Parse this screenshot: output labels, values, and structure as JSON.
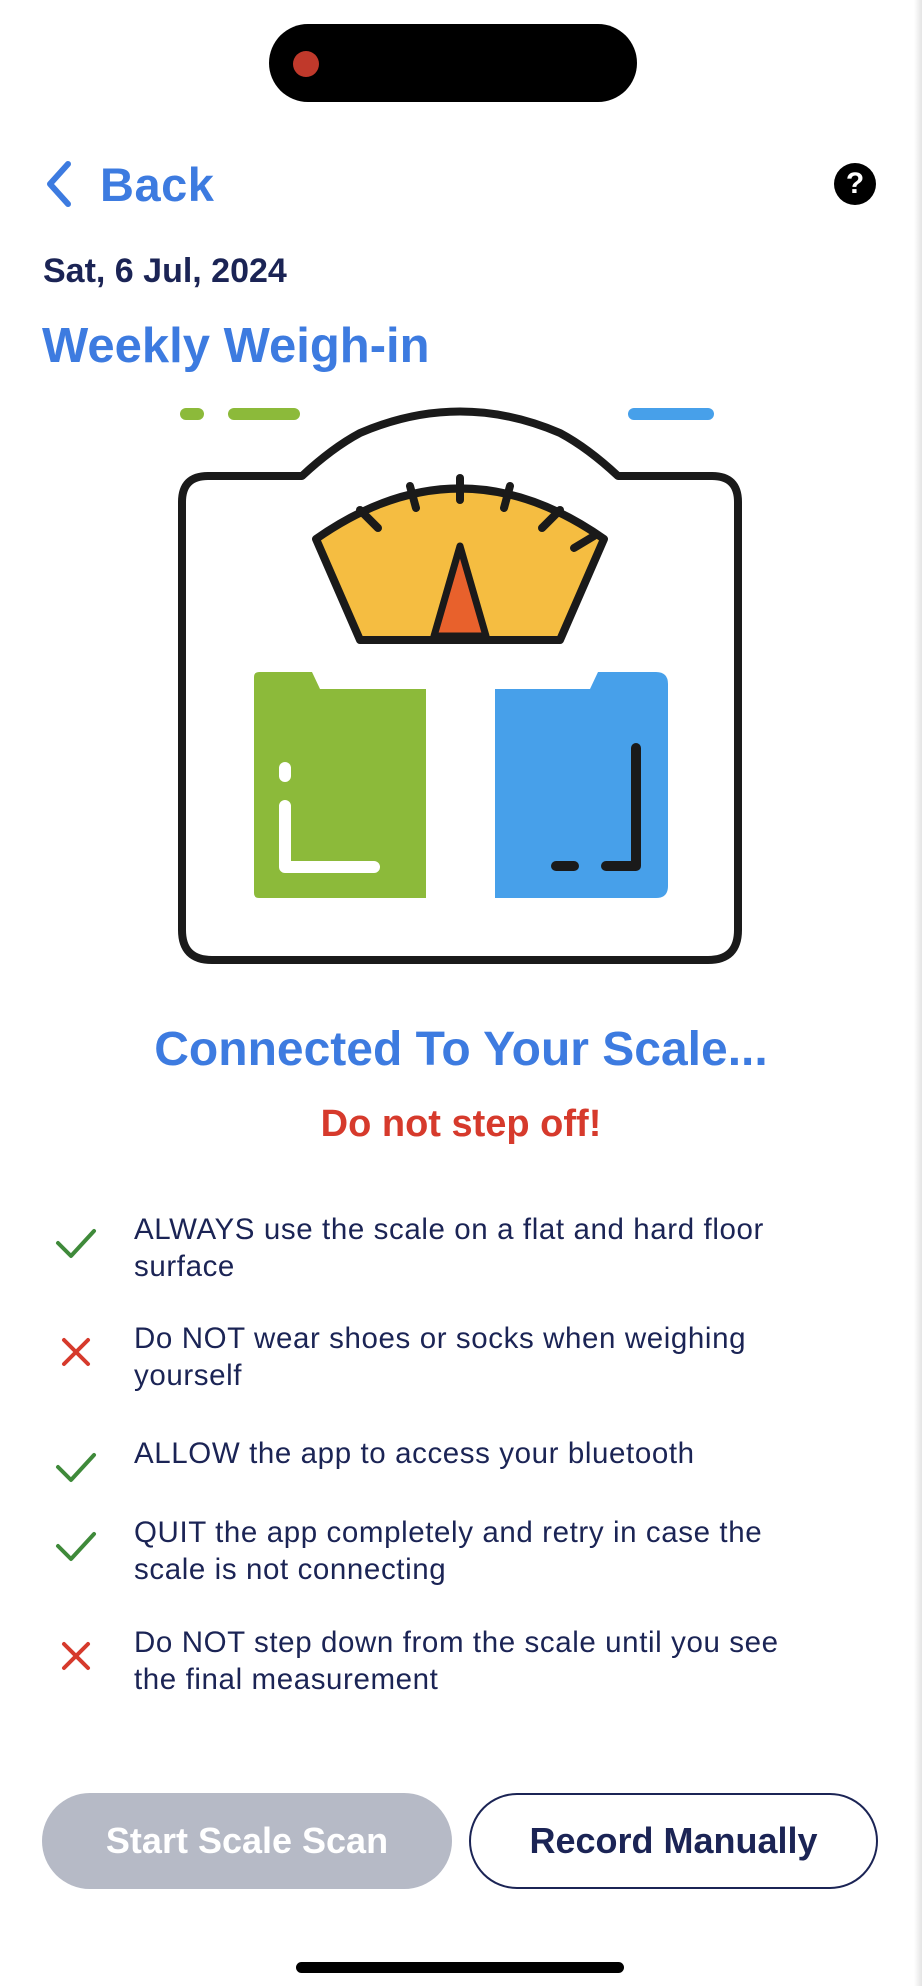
{
  "nav": {
    "back_label": "Back",
    "help_glyph": "?"
  },
  "header": {
    "date": "Sat, 6 Jul, 2024",
    "title": "Weekly Weigh-in"
  },
  "illustration": {
    "name": "bathroom-scale-icon",
    "colors": {
      "dial": "#f5bd41",
      "needle": "#e8612c",
      "left_foot": "#8cba3a",
      "right_foot": "#47a0ea",
      "outline": "#1a1a1a"
    }
  },
  "status": {
    "connected": "Connected To Your Scale...",
    "warning": "Do not step off!"
  },
  "tips": [
    {
      "type": "do",
      "icon": "check-icon",
      "lines": [
        "ALWAYS use the scale on a flat and hard floor",
        "surface"
      ]
    },
    {
      "type": "dont",
      "icon": "cross-icon",
      "lines": [
        "Do NOT wear shoes or socks when weighing",
        "yourself"
      ]
    },
    {
      "type": "do",
      "icon": "check-icon",
      "lines": [
        "ALLOW the app to access your bluetooth"
      ]
    },
    {
      "type": "do",
      "icon": "check-icon",
      "lines": [
        "QUIT the app completely and retry in case the",
        "scale is not connecting"
      ]
    },
    {
      "type": "dont",
      "icon": "cross-icon",
      "lines": [
        "Do NOT step down from the scale until you see",
        "the final measurement"
      ]
    }
  ],
  "actions": {
    "scan_label": "Start Scale Scan",
    "scan_enabled": false,
    "manual_label": "Record Manually"
  },
  "colors": {
    "accent": "#3d7be0",
    "text": "#1b2455",
    "warning": "#d63a2c",
    "check": "#3f8a3a",
    "cross": "#d63a2c",
    "disabled_button": "#b6bac6"
  }
}
